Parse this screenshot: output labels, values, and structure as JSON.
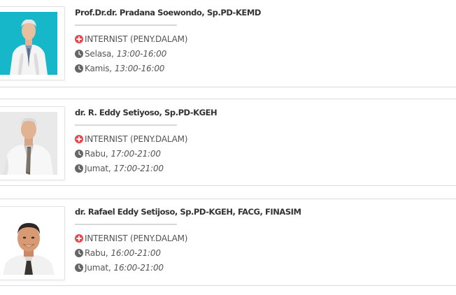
{
  "colors": {
    "specialty_icon": "#e8474f",
    "clock_icon": "#666666",
    "text": "#555555",
    "name": "#333333",
    "divider": "#d8d8d8"
  },
  "doctors": [
    {
      "name": "Prof.Dr.dr. Pradana Soewondo, Sp.PD-KEMD",
      "photo_background": "#15b7c9",
      "specialty": "INTERNIST (PENY.DALAM)",
      "schedule": [
        {
          "day": "Selasa,",
          "time": "13:00-16:00"
        },
        {
          "day": "Kamis,",
          "time": "13:00-16:00"
        }
      ]
    },
    {
      "name": "dr. R. Eddy Setiyoso, Sp.PD-KGEH",
      "photo_background": "#e9e9e9",
      "specialty": "INTERNIST (PENY.DALAM)",
      "schedule": [
        {
          "day": "Rabu,",
          "time": "17:00-21:00"
        },
        {
          "day": "Jumat,",
          "time": "17:00-21:00"
        }
      ]
    },
    {
      "name": "dr. Rafael Eddy Setijoso, Sp.PD-KGEH, FACG, FINASIM",
      "photo_background": "#ffffff",
      "specialty": "INTERNIST (PENY.DALAM)",
      "schedule": [
        {
          "day": "Rabu,",
          "time": "16:00-21:00"
        },
        {
          "day": "Jumat,",
          "time": "16:00-21:00"
        }
      ]
    }
  ]
}
